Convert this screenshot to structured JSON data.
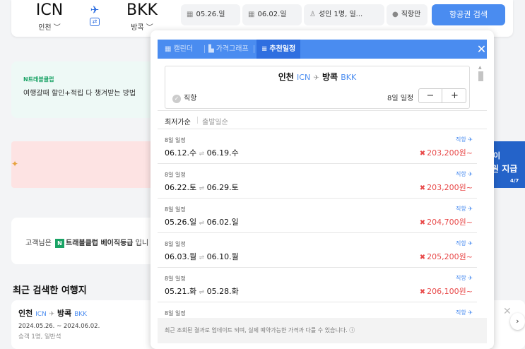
{
  "searchbar": {
    "from": {
      "code": "ICN",
      "city": "인천"
    },
    "to": {
      "code": "BKK",
      "city": "방콕"
    },
    "depart_date": "05.26.일",
    "return_date": "06.02.일",
    "passengers": "성인 1명, 일...",
    "direct_only": "직항만",
    "search_label": "항공권 검색"
  },
  "promo": {
    "title": "N트래블클럽",
    "subtitle": "여행갈때 할인+적립 다 챙겨받는 방법"
  },
  "banner": {
    "line1": "이",
    "line2": "원 지급",
    "line3": "4/7"
  },
  "membership": {
    "prefix": "고객님은",
    "badge": "N",
    "grade": "트래블클럽 베이직등급",
    "suffix": "입니"
  },
  "recent": {
    "title": "최근 검색한 여행지",
    "item": {
      "from": "인천",
      "from_code": "ICN",
      "to": "방콕",
      "to_code": "BKK",
      "dates": "2024.05.26. ~ 2024.06.02.",
      "detail": "승객 1명, 일반석"
    }
  },
  "popup": {
    "tabs": {
      "calendar": "캘린더",
      "graph": "가격그래프",
      "recommend": "추천일정"
    },
    "route": {
      "from": "인천",
      "from_code": "ICN",
      "to": "방콕",
      "to_code": "BKK"
    },
    "direct": "직항",
    "days_label": "8일 일정",
    "stepper_minus": "−",
    "stepper_plus": "+",
    "sort": {
      "lowest": "최저가순",
      "departure": "출발일순"
    },
    "results": [
      {
        "duration": "8일 일정",
        "depart": "06.12.수",
        "return": "06.19.수",
        "type": "직항",
        "price": "203,200원~"
      },
      {
        "duration": "8일 일정",
        "depart": "06.22.토",
        "return": "06.29.토",
        "type": "직항",
        "price": "203,200원~"
      },
      {
        "duration": "8일 일정",
        "depart": "05.26.일",
        "return": "06.02.일",
        "type": "직항",
        "price": "204,700원~"
      },
      {
        "duration": "8일 일정",
        "depart": "06.03.월",
        "return": "06.10.월",
        "type": "직항",
        "price": "205,200원~"
      },
      {
        "duration": "8일 일정",
        "depart": "05.21.화",
        "return": "05.28.화",
        "type": "직항",
        "price": "206,100원~"
      },
      {
        "duration": "8일 일정",
        "depart": "",
        "return": "",
        "type": "직항",
        "price": ""
      }
    ],
    "footer": "최근 조회된 결과로 업데이트 되며, 실제 예약가능한 가격과 다를 수 있습니다. ⓘ"
  },
  "colors": {
    "accent": "#4a8cf0",
    "tab_active": "#2f6fe0",
    "price": "#e84a4a",
    "promo_green": "#1aa365"
  }
}
